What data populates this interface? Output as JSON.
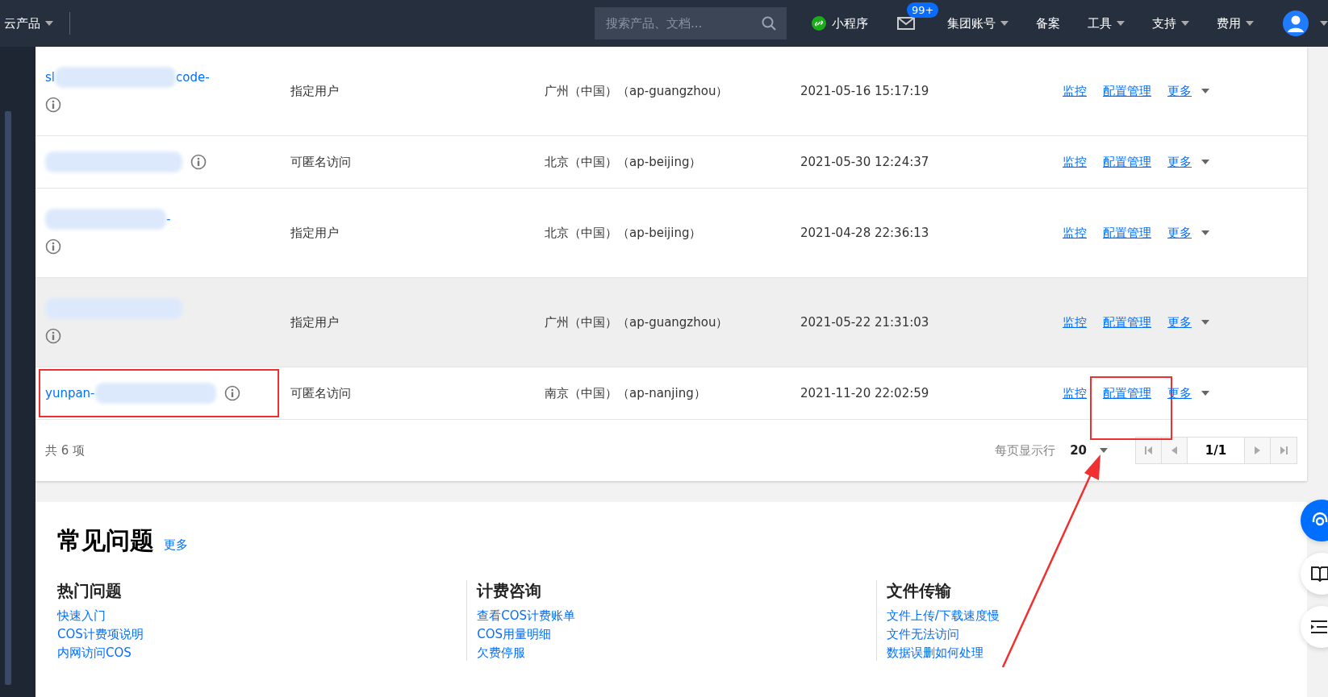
{
  "topbar": {
    "products": "云产品",
    "search": {
      "placeholder": "搜索产品、文档..."
    },
    "mini_program": "小程序",
    "mail_badge": "99+",
    "menus": [
      {
        "label": "集团账号",
        "dropdown": true
      },
      {
        "label": "备案",
        "dropdown": false
      },
      {
        "label": "工具",
        "dropdown": true
      },
      {
        "label": "支持",
        "dropdown": true
      },
      {
        "label": "费用",
        "dropdown": true
      }
    ]
  },
  "table": {
    "rows": [
      {
        "kind": "tall",
        "name_start": "sl",
        "name_end": "code-",
        "hovered": false,
        "name_marked": false,
        "access": "指定用户",
        "region": "广州（中国）（ap-guangzhou）",
        "created": "2021-05-16 15:17:19",
        "actions": [
          {
            "label": "监控",
            "marked": false
          },
          {
            "label": "配置管理",
            "marked": false
          },
          {
            "label": "更多",
            "marked": false
          }
        ]
      },
      {
        "kind": "short",
        "hovered": false,
        "name_marked": false,
        "access": "可匿名访问",
        "region": "北京（中国）（ap-beijing）",
        "created": "2021-05-30 12:24:37",
        "actions": [
          {
            "label": "监控",
            "marked": false
          },
          {
            "label": "配置管理",
            "marked": false
          },
          {
            "label": "更多",
            "marked": false
          }
        ]
      },
      {
        "kind": "tall",
        "name_end": "-",
        "hovered": false,
        "name_marked": false,
        "access": "指定用户",
        "region": "北京（中国）（ap-beijing）",
        "created": "2021-04-28 22:36:13",
        "actions": [
          {
            "label": "监控",
            "marked": false
          },
          {
            "label": "配置管理",
            "marked": false
          },
          {
            "label": "更多",
            "marked": false
          }
        ]
      },
      {
        "kind": "tall",
        "hovered": true,
        "name_marked": false,
        "access": "指定用户",
        "region": "广州（中国）（ap-guangzhou）",
        "created": "2021-05-22 21:31:03",
        "actions": [
          {
            "label": "监控",
            "marked": false
          },
          {
            "label": "配置管理",
            "marked": false
          },
          {
            "label": "更多",
            "marked": false
          }
        ]
      },
      {
        "kind": "short",
        "name_start": "yunpan-",
        "hovered": false,
        "name_marked": true,
        "access": "可匿名访问",
        "region": "南京（中国）（ap-nanjing）",
        "created": "2021-11-20 22:02:59",
        "actions": [
          {
            "label": "监控",
            "marked": false
          },
          {
            "label": "配置管理",
            "marked": true
          },
          {
            "label": "更多",
            "marked": false
          }
        ]
      }
    ],
    "total": "共 6 项",
    "page_size_label": "每页显示行",
    "page_size": "20",
    "page_size_marked": true,
    "page": "1/1"
  },
  "faq": {
    "title": "常见问题",
    "more": "更多",
    "groups": [
      {
        "heading": "热门问题",
        "links": [
          "快速入门",
          "COS计费项说明",
          "内网访问COS"
        ]
      },
      {
        "heading": "计费咨询",
        "links": [
          "查看COS计费账单",
          "COS用量明细",
          "欠费停服"
        ]
      },
      {
        "heading": "文件传输",
        "links": [
          "文件上传/下载速度慢",
          "文件无法访问",
          "数据误删如何处理"
        ]
      }
    ]
  }
}
